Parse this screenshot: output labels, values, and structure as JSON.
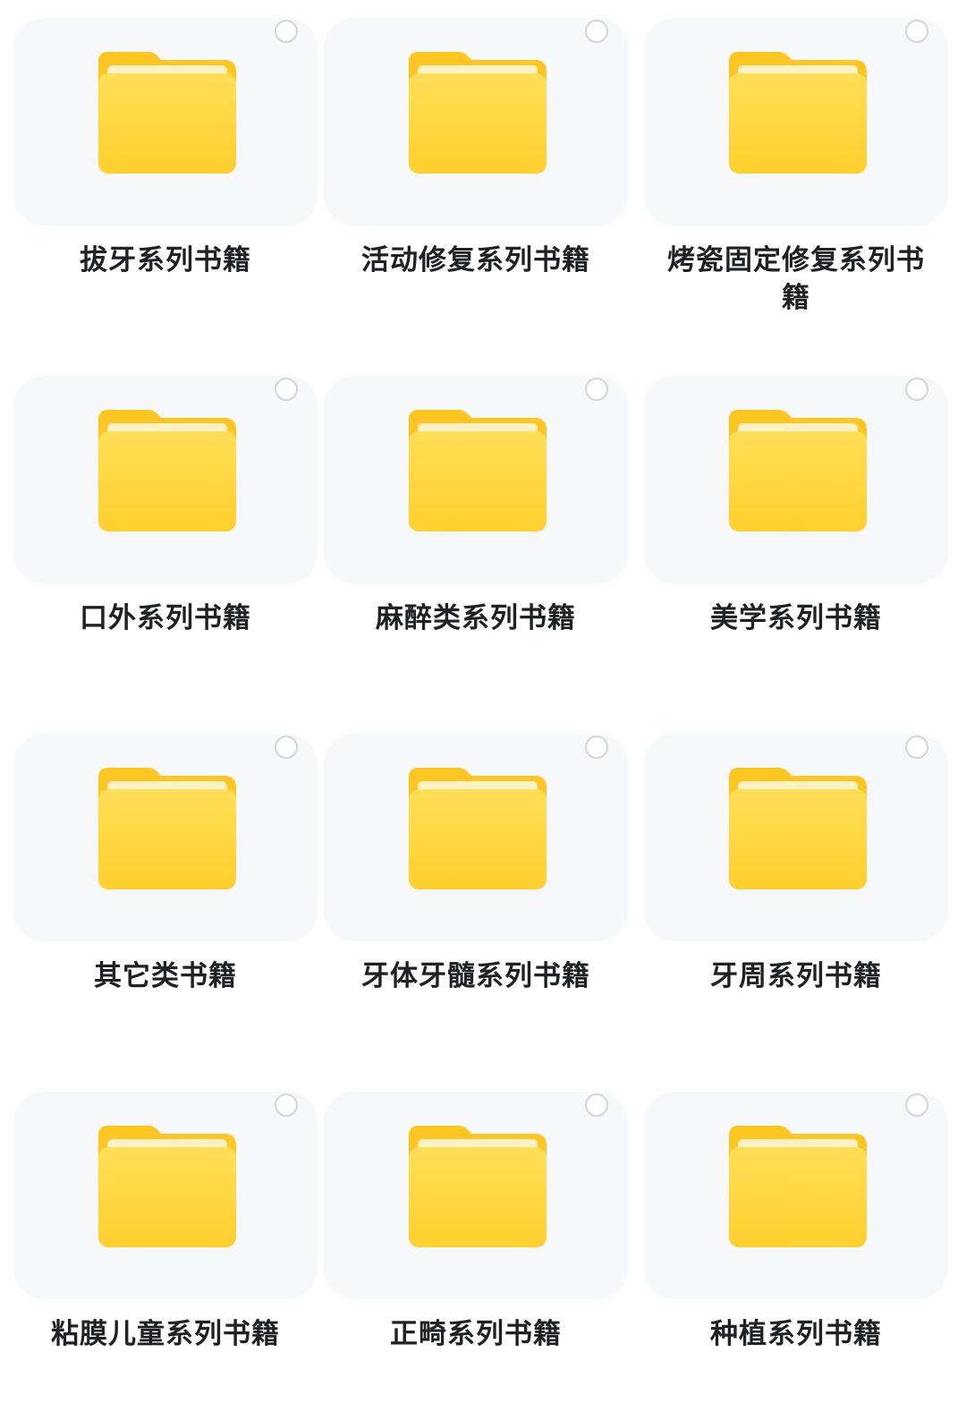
{
  "folders": [
    {
      "label": "拔牙系列书籍"
    },
    {
      "label": "活动修复系列书籍"
    },
    {
      "label": "烤瓷固定修复系列书籍"
    },
    {
      "label": "口外系列书籍"
    },
    {
      "label": "麻醉类系列书籍"
    },
    {
      "label": "美学系列书籍"
    },
    {
      "label": "其它类书籍"
    },
    {
      "label": "牙体牙髓系列书籍"
    },
    {
      "label": "牙周系列书籍"
    },
    {
      "label": "粘膜儿童系列书籍"
    },
    {
      "label": "正畸系列书籍"
    },
    {
      "label": "种植系列书籍"
    }
  ],
  "icons": {
    "folder": "folder-icon",
    "checkbox": "select-circle"
  },
  "colors": {
    "folder_top": "#ffd23a",
    "folder_body": "#ffd84a",
    "folder_tab": "#ffc21a",
    "card_bg": "#f7f8fa"
  }
}
